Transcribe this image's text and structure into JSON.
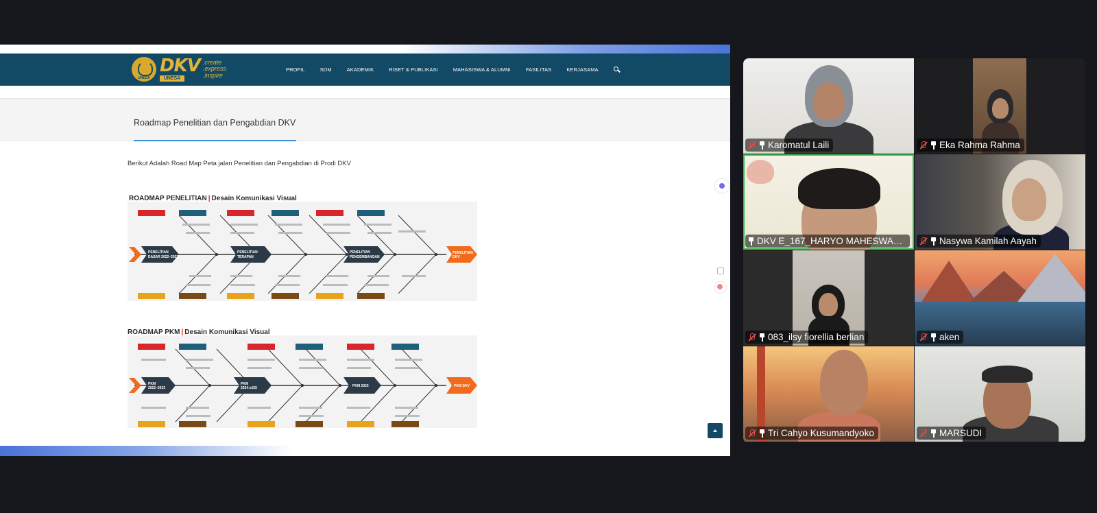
{
  "website": {
    "logo": {
      "name": "DKV",
      "sub": "UNESA",
      "seal": "UNESA",
      "tagline": [
        ".create",
        ".express",
        ".inspire"
      ]
    },
    "nav": [
      "PROFIL",
      "SDM",
      "AKADEMIK",
      "RISET & PUBLIKASI",
      "MAHASISWA & ALUMNI",
      "FASILITAS",
      "KERJASAMA"
    ],
    "page_title": "Roadmap Penelitian dan Pengabdian DKV",
    "intro": "Berikut Adalah Road Map Peta jalan Penelitian dan Pengabdian di Prodi DKV",
    "roadmap_penelitian": {
      "title_a": "ROADMAP PENELITIAN",
      "sep": "|",
      "title_b": "Desain Komunikasi Visual",
      "stages": [
        "PENELITIAN DASAR 2022 – 2023",
        "PENELITIAN TERAPAN 2024 – 2025",
        "PENELITIAN PENGEMBANGAN 2026"
      ],
      "goal": "PENELITIAN DKV"
    },
    "roadmap_pkm": {
      "title_a": "ROADMAP PKM",
      "sep": "|",
      "title_b": "Desain Komunikasi Visual",
      "stages": [
        "PKM 2022 – 2023",
        "PKM 2024-2025",
        "PKM 2026"
      ],
      "goal": "PKM DKV"
    }
  },
  "participants": [
    {
      "name": "Karomatul Laili",
      "muted": true,
      "active": false
    },
    {
      "name": "Eka Rahma Rahma",
      "muted": true,
      "active": false
    },
    {
      "name": "DKV E_167_HARYO MAHESWARA...",
      "muted": false,
      "active": true
    },
    {
      "name": "Nasywa Kamilah Aayah",
      "muted": true,
      "active": false
    },
    {
      "name": "083_ilsy fiorellia berlian",
      "muted": true,
      "active": false
    },
    {
      "name": "aken",
      "muted": true,
      "active": false
    },
    {
      "name": "Tri Cahyo Kusumandyoko",
      "muted": true,
      "active": false
    },
    {
      "name": "MARSUDI",
      "muted": true,
      "active": false
    }
  ],
  "colors": {
    "header": "#124a66",
    "accent_gold": "#e3b33a",
    "goal_orange": "#f26a1b",
    "active_speaker": "#3fbf4f",
    "muted_red": "#e14b4b"
  }
}
